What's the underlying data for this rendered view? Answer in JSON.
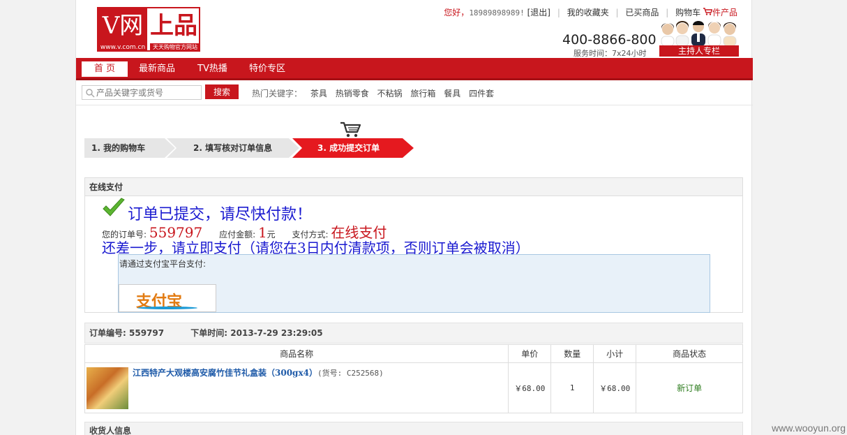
{
  "header": {
    "logo_v": "V网",
    "logo_name": "上品",
    "logo_url": "www.v.com.cn",
    "logo_slogan": "天天购物官方网站",
    "greeting": "您好，",
    "user_phone": "18989898989!",
    "logout": "[退出]",
    "links": [
      "我的收藏夹",
      "已买商品",
      "购物车"
    ],
    "cart_count": "件产品",
    "hotline": "400-8866-800",
    "service_hours": "服务时间：7x24小时",
    "host_column": "主持人专栏"
  },
  "nav": {
    "items": [
      "首 页",
      "最新商品",
      "TV热播",
      "特价专区"
    ]
  },
  "search": {
    "placeholder": "产品关键字或货号",
    "button": "搜索",
    "hot_label": "热门关键字：",
    "keywords": [
      "茶具",
      "热销零食",
      "不粘锅",
      "旅行箱",
      "餐具",
      "四件套"
    ]
  },
  "steps": [
    "1. 我的购物车",
    "2. 填写核对订单信息",
    "3. 成功提交订单"
  ],
  "payment": {
    "panel_title": "在线支付",
    "submitted_msg": "订单已提交，请尽快付款！",
    "order_no_label": "您的订单号:",
    "order_no": "559797",
    "amount_label": "应付金额:",
    "amount": "1",
    "amount_unit": "元",
    "method_label": "支付方式:",
    "method": "在线支付",
    "reminder": "还差一步，请立即支付（请您在3日内付清款项，否则订单会被取消）",
    "platform_label": "请通过支付宝平台支付:",
    "alipay_text": "支付宝"
  },
  "order": {
    "no_label": "订单编号:",
    "no": "559797",
    "time_label": "下单时间:",
    "time": "2013-7-29 23:29:05",
    "columns": [
      "商品名称",
      "单价",
      "数量",
      "小计",
      "商品状态"
    ],
    "items": [
      {
        "name": "江西特产大观楼高安腐竹佳节礼盒装（300gx4）",
        "code": "(货号: C252568)",
        "price": "￥68.00",
        "qty": "1",
        "subtotal": "￥68.00",
        "status": "新订单"
      }
    ]
  },
  "receiver_title": "收货人信息",
  "watermark": "www.wooyun.org",
  "colors": {
    "brand_red": "#c8161d",
    "link_blue": "#1e5aa8",
    "message_blue": "#1a1ad0"
  }
}
